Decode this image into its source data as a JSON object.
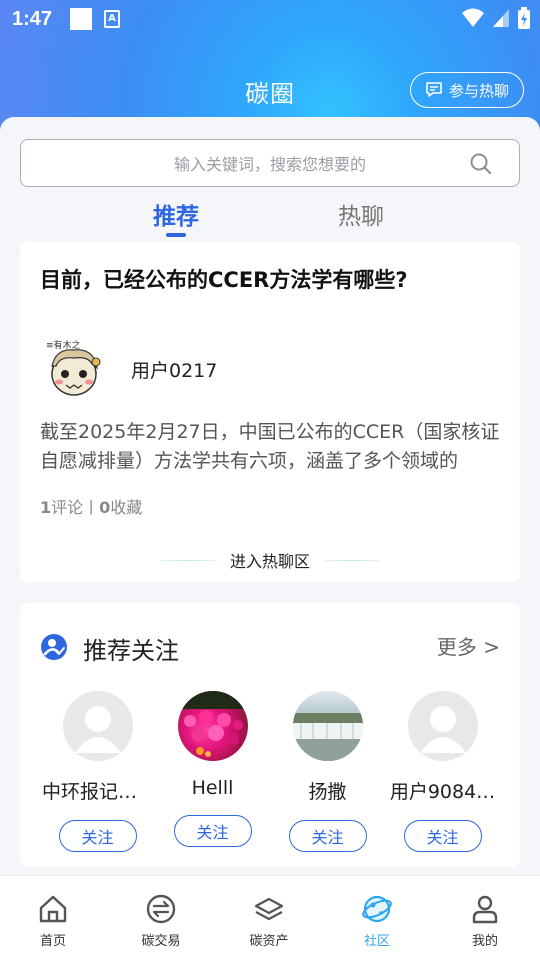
{
  "status": {
    "time": "1:47"
  },
  "header": {
    "title": "碳圈",
    "join_chat_label": "参与热聊"
  },
  "search": {
    "placeholder": "输入关键词，搜索您想要的"
  },
  "tabs": [
    {
      "label": "推荐",
      "active": true
    },
    {
      "label": "热聊",
      "active": false
    }
  ],
  "post": {
    "title": "目前，已经公布的CCER方法学有哪些?",
    "author": "用户0217",
    "excerpt": "截至2025年2月27日，中国已公布的CCER（国家核证自愿减排量）方法学共有六项，涵盖了多个领域的",
    "comments": "1",
    "comments_label": "评论",
    "separator": "丨",
    "favorites": "0",
    "favorites_label": "收藏",
    "enter_label": "进入热聊区"
  },
  "recommend_follow": {
    "title": "推荐关注",
    "more_label": "更多 >",
    "follow_label": "关注",
    "users": [
      {
        "name": "中环报记者…",
        "avatar": "default-avatar"
      },
      {
        "name": "Helll",
        "avatar": "flower-photo"
      },
      {
        "name": "扬撒",
        "avatar": "waterfall-photo"
      },
      {
        "name": "用户9084…",
        "avatar": "default-avatar"
      }
    ]
  },
  "bottom_nav": [
    {
      "label": "首页",
      "icon": "home-icon",
      "active": false
    },
    {
      "label": "碳交易",
      "icon": "exchange-icon",
      "active": false
    },
    {
      "label": "碳资产",
      "icon": "layers-icon",
      "active": false
    },
    {
      "label": "社区",
      "icon": "community-planet-icon",
      "active": true
    },
    {
      "label": "我的",
      "icon": "profile-icon",
      "active": false
    }
  ],
  "colors": {
    "accent": "#2e67e0",
    "nav_active": "#2da5f0"
  }
}
